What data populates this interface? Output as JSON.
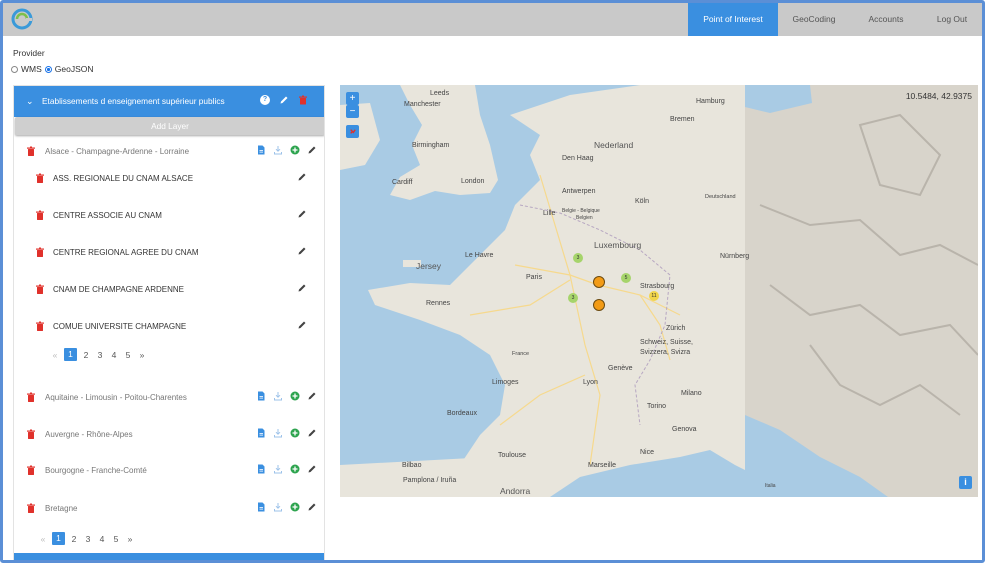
{
  "nav": {
    "items": [
      "Point of Interest",
      "GeoCoding",
      "Accounts",
      "Log Out"
    ],
    "active_index": 0
  },
  "provider": {
    "label": "Provider",
    "options": [
      "WMS",
      "GeoJSON"
    ],
    "selected": "GeoJSON"
  },
  "layer": {
    "title": "Etablissements d enseignement supérieur publics",
    "add_layer_label": "Add Layer"
  },
  "groups_top": [
    {
      "label": "Alsace - Champagne-Ardenne - Lorraine"
    }
  ],
  "items": [
    {
      "label": "ASS. REGIONALE DU CNAM ALSACE"
    },
    {
      "label": "CENTRE ASSOCIE AU CNAM"
    },
    {
      "label": "CENTRE REGIONAL AGREE DU CNAM"
    },
    {
      "label": "CNAM DE CHAMPAGNE ARDENNE"
    },
    {
      "label": "COMUE UNIVERSITE CHAMPAGNE"
    }
  ],
  "inner_pager": {
    "prev": "«",
    "pages": [
      "1",
      "2",
      "3",
      "4",
      "5"
    ],
    "next": "»",
    "active": "1"
  },
  "groups_bottom": [
    {
      "label": "Aquitaine - Limousin - Poitou-Charentes"
    },
    {
      "label": "Auvergne - Rhône-Alpes"
    },
    {
      "label": "Bourgogne - Franche-Comté"
    },
    {
      "label": "Bretagne"
    }
  ],
  "outer_pager": {
    "prev": "«",
    "pages": [
      "1",
      "2",
      "3",
      "4",
      "5"
    ],
    "next": "»",
    "active": "1"
  },
  "map": {
    "coords": "10.5484, 42.9375",
    "zoom_in": "+",
    "zoom_out": "−",
    "info": "i",
    "labels": {
      "leeds": "Leeds",
      "manchester": "Manchester",
      "hamburg": "Hamburg",
      "bremen": "Bremen",
      "birmingham": "Birmingham",
      "nederland": "Nederland",
      "den_haag": "Den Haag",
      "cardiff": "Cardiff",
      "london": "London",
      "antwerpen": "Antwerpen",
      "koln": "Köln",
      "deutschland": "Deutschland",
      "lille": "Lille",
      "belgie": "Belgie - Belgique",
      "belgien": "Belgien",
      "luxembourg": "Luxembourg",
      "jersey": "Jersey",
      "le_havre": "Le Havre",
      "nurnberg": "Nürnberg",
      "paris": "Paris",
      "strasbourg": "Strasbourg",
      "rennes": "Rennes",
      "zurich": "Zürich",
      "schweiz": "Schweiz, Suisse,",
      "svizzera": "Svizzera, Svizra",
      "france": "France",
      "geneve": "Genève",
      "limoges": "Limoges",
      "lyon": "Lyon",
      "milano": "Milano",
      "bordeaux": "Bordeaux",
      "torino": "Torino",
      "genova": "Genova",
      "toulouse": "Toulouse",
      "nice": "Nice",
      "bilbao": "Bilbao",
      "marseille": "Marseille",
      "pamplona": "Pamplona / Iruña",
      "andorra": "Andorra",
      "italia": "Italia"
    },
    "clusters": [
      {
        "count": "3"
      },
      {
        "count": "5"
      },
      {
        "count": "3"
      },
      {
        "count": "11"
      }
    ]
  },
  "colors": {
    "accent": "#3a8fe0",
    "trash": "#e0312b",
    "plus": "#2ea44f",
    "topbar": "#c9c9c9"
  }
}
